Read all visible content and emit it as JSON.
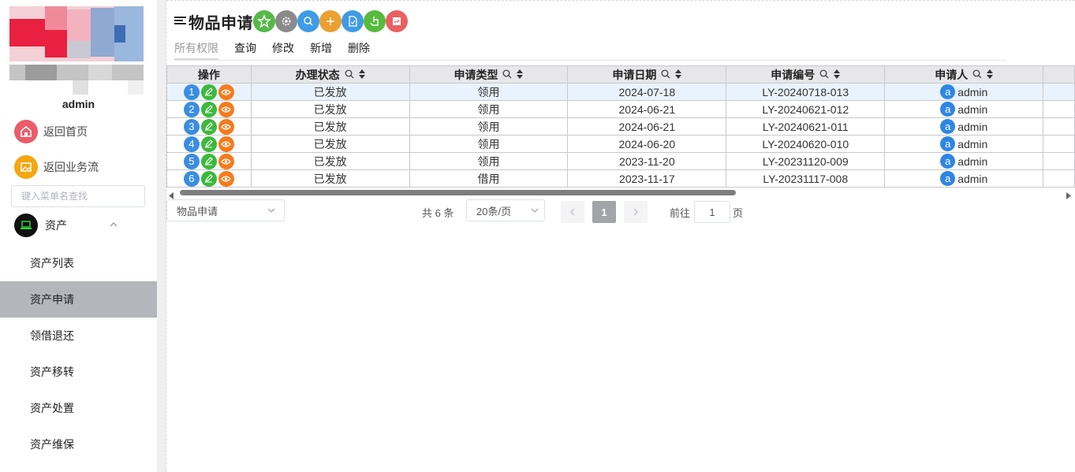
{
  "sidebar": {
    "username": "admin",
    "home_label": "返回首页",
    "flow_label": "返回业务流",
    "search_placeholder": "键入菜单名查找",
    "group": {
      "label": "资产",
      "icon": "laptop-icon"
    },
    "items": [
      {
        "label": "资产列表",
        "active": false
      },
      {
        "label": "资产申请",
        "active": true
      },
      {
        "label": "领借退还",
        "active": false
      },
      {
        "label": "资产移转",
        "active": false
      },
      {
        "label": "资产处置",
        "active": false
      },
      {
        "label": "资产维保",
        "active": false
      }
    ]
  },
  "header": {
    "title": "物品申请",
    "toolbar_icons": [
      "star-icon",
      "gear-icon",
      "search-icon",
      "plus-icon",
      "document-icon",
      "hand-pointer-icon",
      "chart-icon"
    ]
  },
  "tabs": [
    "所有权限",
    "查询",
    "修改",
    "新增",
    "删除"
  ],
  "table": {
    "headers": [
      "操作",
      "办理状态",
      "申请类型",
      "申请日期",
      "申请编号",
      "申请人"
    ],
    "rows": [
      {
        "n": "1",
        "status": "已发放",
        "type": "领用",
        "date": "2024-07-18",
        "code": "LY-20240718-013",
        "avatar": "a",
        "user": "admin"
      },
      {
        "n": "2",
        "status": "已发放",
        "type": "领用",
        "date": "2024-06-21",
        "code": "LY-20240621-012",
        "avatar": "a",
        "user": "admin"
      },
      {
        "n": "3",
        "status": "已发放",
        "type": "领用",
        "date": "2024-06-21",
        "code": "LY-20240621-011",
        "avatar": "a",
        "user": "admin"
      },
      {
        "n": "4",
        "status": "已发放",
        "type": "领用",
        "date": "2024-06-20",
        "code": "LY-20240620-010",
        "avatar": "a",
        "user": "admin"
      },
      {
        "n": "5",
        "status": "已发放",
        "type": "领用",
        "date": "2023-11-20",
        "code": "LY-20231120-009",
        "avatar": "a",
        "user": "admin"
      },
      {
        "n": "6",
        "status": "已发放",
        "type": "借用",
        "date": "2023-11-17",
        "code": "LY-20231117-008",
        "avatar": "a",
        "user": "admin"
      }
    ]
  },
  "pager": {
    "form_select": "物品申请",
    "total": "共 6 条",
    "size_select": "20条/页",
    "current_page": "1",
    "goto_label": "前往",
    "goto_value": "1",
    "page_suffix": "页"
  },
  "colors": {
    "green": "#3cb93c",
    "orange": "#f57b1d",
    "blue": "#3b8de0",
    "red": "#e85c5c",
    "active_bg": "#b4b6bb"
  }
}
